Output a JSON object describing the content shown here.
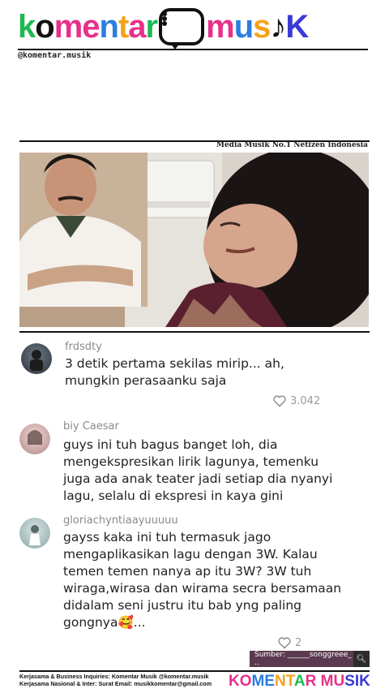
{
  "header": {
    "logo_letters": [
      {
        "ch": "k",
        "color": "#1db954"
      },
      {
        "ch": "o",
        "color": "#111111"
      },
      {
        "ch": "m",
        "color": "#e8308a"
      },
      {
        "ch": "e",
        "color": "#e8308a"
      },
      {
        "ch": "n",
        "color": "#2a7de1"
      },
      {
        "ch": "t",
        "color": "#f5a21a"
      },
      {
        "ch": "a",
        "color": "#e8308a"
      },
      {
        "ch": "r",
        "color": "#1db954"
      }
    ],
    "logo_tail": [
      {
        "ch": "m",
        "color": "#e8308a"
      },
      {
        "ch": "u",
        "color": "#2a7de1"
      },
      {
        "ch": "s",
        "color": "#f5a21a"
      },
      {
        "ch": "♪",
        "color": "#111111"
      },
      {
        "ch": "K",
        "color": "#3a3ad6"
      }
    ],
    "handle": "@komentar.musik"
  },
  "tagline": "Media Musik No.1 Netizen Indonesia",
  "comments": [
    {
      "username": "frdsdty",
      "text": "3 detik pertama sekilas mirip... ah, mungkin perasaanku saja",
      "likes": "3.042"
    },
    {
      "username": "biy Caesar",
      "text": "guys ini tuh bagus banget loh, dia mengekspresikan lirik lagunya, temenku juga ada anak teater jadi setiap dia nyanyi lagu, selalu di ekspresi in kaya gini",
      "likes": ""
    },
    {
      "username": "gloriachyntiaayuuuuu",
      "text": "gayss kaka ini tuh termasuk jago mengaplikasikan lagu dengan 3W. Kalau temen temen nanya ap itu 3W? 3W tuh wiraga,wirasa dan wirama secra bersamaan didalam seni justru itu bab yng paling gongnya🥰...",
      "likes": "2"
    }
  ],
  "footer": {
    "source": "Sumber: ______songgreee_ ..",
    "line1": "Kerjasama & Business Inquiries: Komentar Musik @komentar.musik",
    "line2": "Kerjasama Nasional & Inter: Surat Email: musikkomentar@gmail.com",
    "mini_logo": "KOMENTAR MUSIK"
  },
  "colors": {
    "pill": "#5b3a4f",
    "rule": "#111111"
  },
  "icons": [
    "chat-bubble-icon",
    "heart-icon",
    "search-icon",
    "music-note-icon"
  ]
}
